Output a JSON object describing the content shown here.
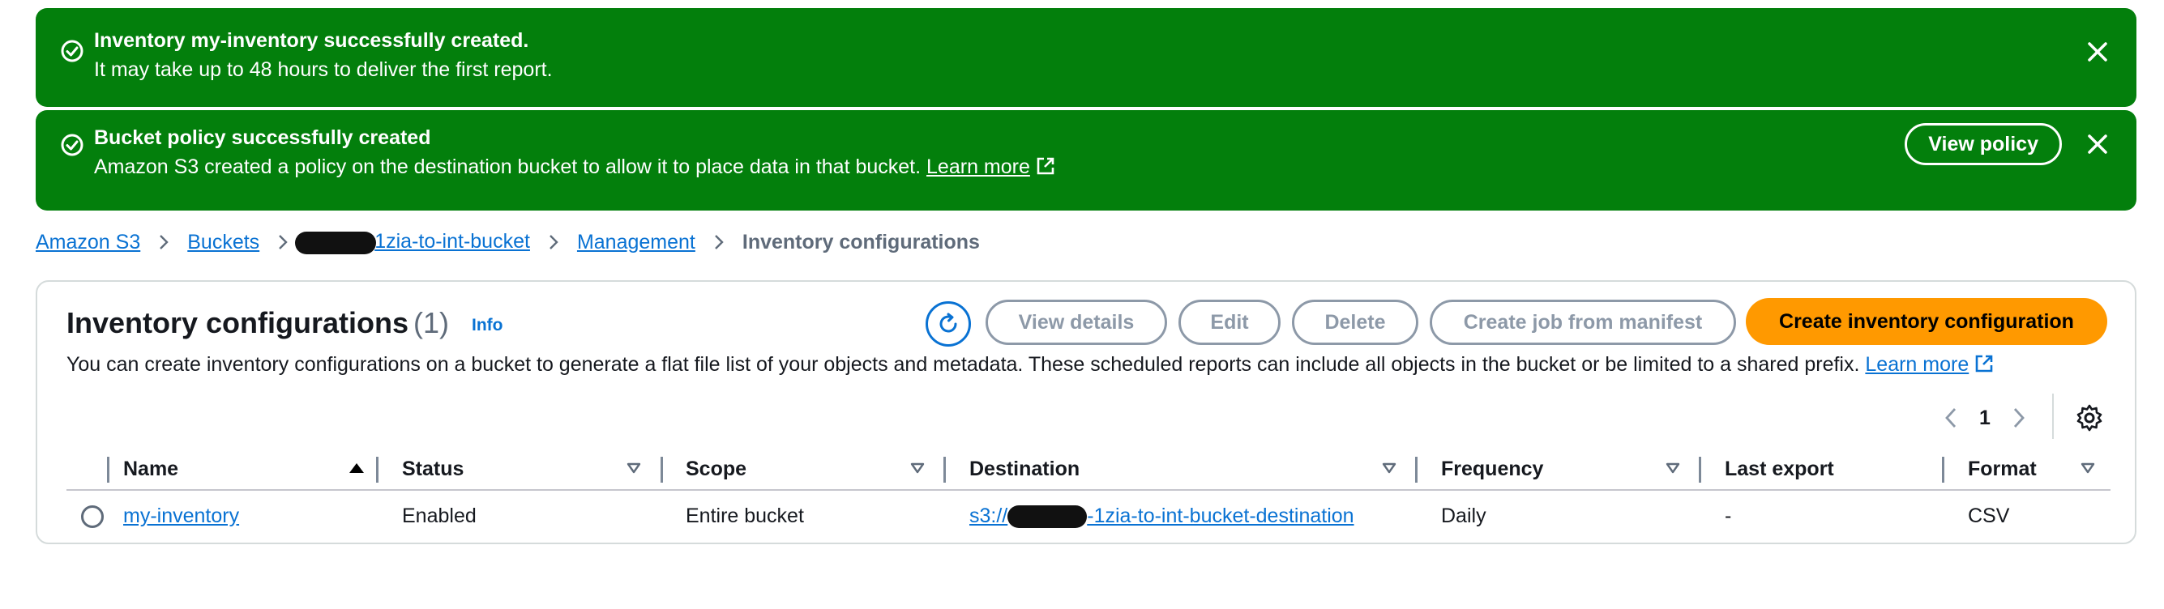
{
  "flash_inventory": {
    "title": "Inventory my-inventory successfully created.",
    "message": "It may take up to 48 hours to deliver the first report."
  },
  "flash_policy": {
    "title": "Bucket policy successfully created",
    "message": "Amazon S3 created a policy on the destination bucket to allow it to place data in that bucket.",
    "link": "Learn more",
    "button": "View policy"
  },
  "breadcrumb": {
    "items": [
      "Amazon S3",
      "Buckets",
      "1zia-to-int-bucket",
      "Management"
    ],
    "current": "Inventory configurations"
  },
  "panel": {
    "title": "Inventory configurations",
    "count": "(1)",
    "info": "Info",
    "description": "You can create inventory configurations on a bucket to generate a flat file list of your objects and metadata. These scheduled reports can include all objects in the bucket or be limited to a shared prefix.",
    "learn_more": "Learn more",
    "buttons": {
      "view_details": "View details",
      "edit": "Edit",
      "delete": "Delete",
      "create_job": "Create job from manifest",
      "create": "Create inventory configuration"
    },
    "page": "1"
  },
  "table": {
    "columns": [
      "Name",
      "Status",
      "Scope",
      "Destination",
      "Frequency",
      "Last export",
      "Format"
    ],
    "rows": [
      {
        "name": "my-inventory",
        "status": "Enabled",
        "scope": "Entire bucket",
        "destination_prefix": "s3://",
        "destination_suffix": "-1zia-to-int-bucket-destination",
        "frequency": "Daily",
        "last_export": "-",
        "format": "CSV"
      }
    ]
  },
  "colors": {
    "success": "#037f0c",
    "link": "#0972d3",
    "primary_button": "#ff9900",
    "disabled": "#8d99a8"
  }
}
